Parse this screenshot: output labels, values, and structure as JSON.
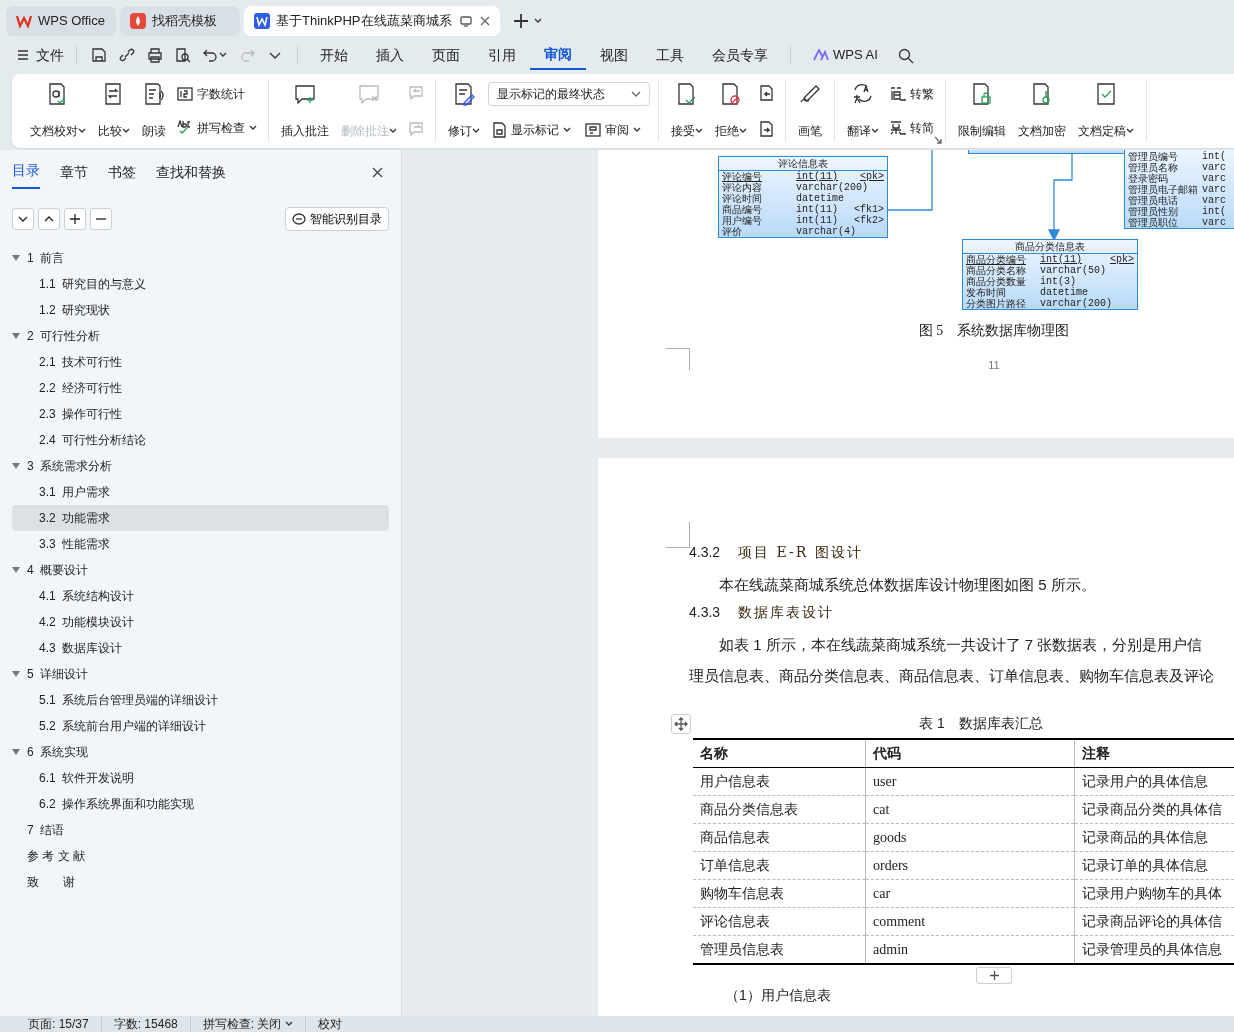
{
  "app_tabs": [
    {
      "label": "WPS Office",
      "selected": false
    },
    {
      "label": "找稻壳模板",
      "selected": false
    },
    {
      "label": "基于ThinkPHP在线蔬菜商城系",
      "selected": true
    }
  ],
  "menu": {
    "file": "文件",
    "ai": "WPS AI",
    "tabs": [
      {
        "label": "开始",
        "selected": false
      },
      {
        "label": "插入",
        "selected": false
      },
      {
        "label": "页面",
        "selected": false
      },
      {
        "label": "引用",
        "selected": false
      },
      {
        "label": "审阅",
        "selected": true
      },
      {
        "label": "视图",
        "selected": false
      },
      {
        "label": "工具",
        "selected": false
      },
      {
        "label": "会员专享",
        "selected": false
      }
    ]
  },
  "ribbon": [
    {
      "columns": [
        {
          "kind": "big",
          "label": "文档校对",
          "caret": true
        },
        {
          "kind": "big",
          "label": "比较",
          "caret": true
        },
        {
          "kind": "big",
          "label": "朗读"
        },
        {
          "kind": "stack",
          "items": [
            {
              "label": "字数统计"
            },
            {
              "label": "拼写检查",
              "caret": true
            }
          ]
        }
      ]
    },
    {
      "columns": [
        {
          "kind": "big",
          "label": "插入批注"
        },
        {
          "kind": "big",
          "label": "删除批注",
          "caret": true,
          "disabled": true
        },
        {
          "kind": "stack",
          "items": [
            {
              "disabled": true
            },
            {
              "disabled": true
            }
          ]
        }
      ]
    },
    {
      "columns": [
        {
          "kind": "big",
          "label": "修订",
          "caret": true
        },
        {
          "kind": "select",
          "value": "显示标记的最终状态",
          "items": [
            {
              "label": "显示标记",
              "caret": true
            },
            {
              "label": "审阅",
              "caret": true
            }
          ]
        }
      ]
    },
    {
      "columns": [
        {
          "kind": "big",
          "label": "接受",
          "caret": true
        },
        {
          "kind": "big",
          "label": "拒绝",
          "caret": true
        },
        {
          "kind": "stack",
          "items": [
            {
              "disabled": false
            },
            {
              "disabled": false
            }
          ]
        }
      ]
    },
    {
      "columns": [
        {
          "kind": "big",
          "label": "画笔"
        }
      ]
    },
    {
      "columns": [
        {
          "kind": "big",
          "label": "翻译",
          "caret": true
        },
        {
          "kind": "stack",
          "items": [
            {
              "label": "转繁"
            },
            {
              "label": "转简"
            }
          ]
        }
      ]
    },
    {
      "columns": [
        {
          "kind": "big",
          "label": "限制编辑"
        },
        {
          "kind": "big",
          "label": "文档加密"
        },
        {
          "kind": "big",
          "label": "文档定稿",
          "caret": true
        }
      ]
    }
  ],
  "sidebar": {
    "tabs": [
      {
        "label": "目录",
        "selected": true
      },
      {
        "label": "章节",
        "selected": false
      },
      {
        "label": "书签",
        "selected": false
      },
      {
        "label": "查找和替换",
        "selected": false
      }
    ],
    "smart_button": "智能识别目录",
    "outline": [
      {
        "num": "1",
        "title": "前言",
        "selected": false,
        "expanded": true,
        "children": [
          {
            "num": "1.1",
            "title": "研究目的与意义",
            "selected": false
          },
          {
            "num": "1.2",
            "title": "研究现状",
            "selected": false
          }
        ]
      },
      {
        "num": "2",
        "title": "可行性分析",
        "selected": false,
        "expanded": true,
        "children": [
          {
            "num": "2.1",
            "title": "技术可行性",
            "selected": false
          },
          {
            "num": "2.2",
            "title": "经济可行性",
            "selected": false
          },
          {
            "num": "2.3",
            "title": "操作可行性",
            "selected": false
          },
          {
            "num": "2.4",
            "title": "可行性分析结论",
            "selected": false
          }
        ]
      },
      {
        "num": "3",
        "title": "系统需求分析",
        "selected": false,
        "expanded": true,
        "children": [
          {
            "num": "3.1",
            "title": "用户需求",
            "selected": false
          },
          {
            "num": "3.2",
            "title": "功能需求",
            "selected": true
          },
          {
            "num": "3.3",
            "title": "性能需求",
            "selected": false
          }
        ]
      },
      {
        "num": "4",
        "title": "概要设计",
        "selected": false,
        "expanded": true,
        "children": [
          {
            "num": "4.1",
            "title": "系统结构设计",
            "selected": false
          },
          {
            "num": "4.2",
            "title": "功能模块设计",
            "selected": false
          },
          {
            "num": "4.3",
            "title": "数据库设计",
            "selected": false
          }
        ]
      },
      {
        "num": "5",
        "title": "详细设计",
        "selected": false,
        "expanded": true,
        "children": [
          {
            "num": "5.1",
            "title": "系统后台管理员端的详细设计",
            "selected": false
          },
          {
            "num": "5.2",
            "title": "系统前台用户端的详细设计",
            "selected": false
          }
        ]
      },
      {
        "num": "6",
        "title": "系统实现",
        "selected": false,
        "expanded": true,
        "children": [
          {
            "num": "6.1",
            "title": "软件开发说明",
            "selected": false
          },
          {
            "num": "6.2",
            "title": "操作系统界面和功能实现",
            "selected": false
          }
        ]
      },
      {
        "num": "7",
        "title": "结语",
        "selected": false
      },
      {
        "title": "参 考 文 献",
        "selected": false
      },
      {
        "title": "致　　谢",
        "selected": false
      }
    ]
  },
  "page_top": {
    "diagram": [
      {
        "title": "评论信息表",
        "fields": [
          [
            "评论编号",
            "int(11)",
            "<pk>"
          ],
          [
            "评论内容",
            "varchar(200)"
          ],
          [
            "评论时间",
            "datetime"
          ],
          [
            "商品编号",
            "int(11)",
            "<fk1>"
          ],
          [
            "用户编号",
            "int(11)",
            "<fk2>"
          ],
          [
            "评价",
            "varchar(4)"
          ]
        ]
      },
      {
        "title": "商品分类信息表",
        "fields": [
          [
            "商品分类编号",
            "int(11)",
            "<pk>"
          ],
          [
            "商品分类名称",
            "varchar(50)"
          ],
          [
            "商品分类数量",
            "int(3)"
          ],
          [
            "发布时间",
            "datetime"
          ],
          [
            "分类图片路径",
            "varchar(200)"
          ]
        ]
      },
      {
        "fields": [
          [
            "管理员编号",
            "int("
          ],
          [
            "管理员名称",
            "varc"
          ],
          [
            "登录密码",
            "varc"
          ],
          [
            "管理员电子邮箱",
            "varc"
          ],
          [
            "管理员电话",
            "varc"
          ],
          [
            "管理员性别",
            "int("
          ],
          [
            "管理员职位",
            "varc"
          ]
        ]
      }
    ],
    "caption": "图 5　系统数据库物理图",
    "page_number": "11"
  },
  "page_bottom": {
    "blocks": [
      {
        "kind": "heading",
        "number": "4.3.2",
        "text": "项目 E-R 图设计"
      },
      {
        "kind": "paragraph",
        "lines": [
          "本在线蔬菜商城系统总体数据库设计物理图如图 5 所示。"
        ]
      },
      {
        "kind": "heading",
        "number": "4.3.3",
        "text": "数据库表设计"
      },
      {
        "kind": "paragraph",
        "lines": [
          "如表 1 所示，本在线蔬菜商城系统一共设计了 7 张数据表，分别是用户信",
          "理员信息表、商品分类信息表、商品信息表、订单信息表、购物车信息表及评论"
        ]
      }
    ],
    "table": {
      "caption": "表 1　数据库表汇总",
      "columns": [
        "名称",
        "代码",
        "注释"
      ],
      "rows": [
        [
          "用户信息表",
          "user",
          "记录用户的具体信息"
        ],
        [
          "商品分类信息表",
          "cat",
          "记录商品分类的具体信"
        ],
        [
          "商品信息表",
          "goods",
          "记录商品的具体信息"
        ],
        [
          "订单信息表",
          "orders",
          "记录订单的具体信息"
        ],
        [
          "购物车信息表",
          "car",
          "记录用户购物车的具体"
        ],
        [
          "评论信息表",
          "comment",
          "记录商品评论的具体信"
        ],
        [
          "管理员信息表",
          "admin",
          "记录管理员的具体信息"
        ]
      ]
    },
    "after": "（1）用户信息表"
  },
  "status_bar": [
    {
      "label": "页面: 15/37"
    },
    {
      "label": "字数: 15468"
    },
    {
      "label": "拼写检查: 关闭",
      "caret": true
    },
    {
      "label": "校对"
    }
  ]
}
